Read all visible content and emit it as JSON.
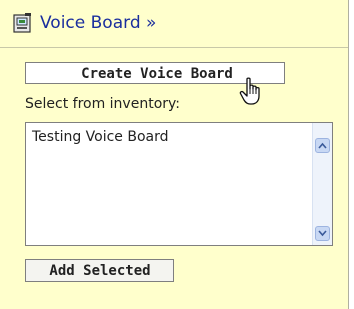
{
  "header": {
    "title": "Voice Board »",
    "icon": "voice-board-icon"
  },
  "actions": {
    "create_label": "Create Voice Board",
    "add_label": "Add Selected"
  },
  "inventory": {
    "label": "Select from inventory:",
    "items": [
      "Testing Voice Board"
    ]
  },
  "colors": {
    "panel_bg": "#ffffcc",
    "link": "#1a2e9e",
    "scrollbar": "#c8d8f4"
  }
}
